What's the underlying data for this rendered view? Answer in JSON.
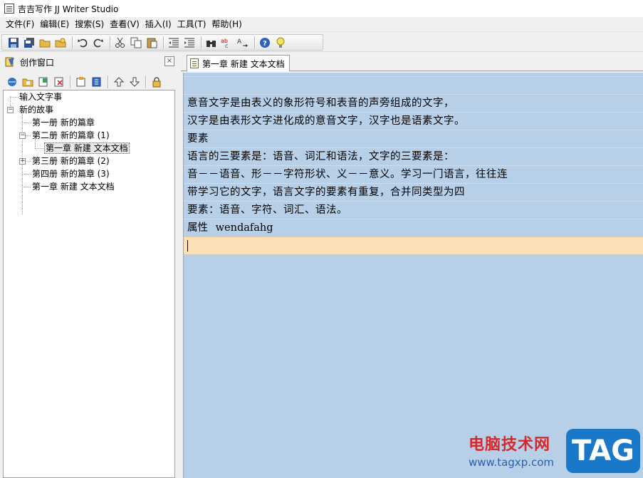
{
  "window": {
    "title": "吉吉写作 JJ Writer Studio"
  },
  "menu": [
    "文件(F)",
    "编辑(E)",
    "搜索(S)",
    "查看(V)",
    "插入(I)",
    "工具(T)",
    "帮助(H)"
  ],
  "toolbar": {
    "buttons": [
      "save-icon",
      "save-all-icon",
      "open-folder-icon",
      "export-icon",
      "undo-icon",
      "redo-icon",
      "cut-icon",
      "copy-icon",
      "paste-icon",
      "outdent-icon",
      "indent-icon",
      "find-icon",
      "spell-check-icon",
      "replace-icon",
      "help-icon",
      "tip-icon"
    ]
  },
  "left_panel": {
    "title": "创作窗口",
    "close_label": "⊠",
    "tree": [
      {
        "label": "输入文字事",
        "level": 0
      },
      {
        "label": "新的故事",
        "level": 0,
        "expander": "−"
      },
      {
        "label": "第一册 新的篇章",
        "level": 1
      },
      {
        "label": "第二册 新的篇章 (1)",
        "level": 1,
        "expander": "−"
      },
      {
        "label": "第一章 新建 文本文档",
        "level": 2,
        "selected": true
      },
      {
        "label": "第三册 新的篇章 (2)",
        "level": 1,
        "expander": "+"
      },
      {
        "label": "第四册 新的篇章 (3)",
        "level": 1
      },
      {
        "label": "第一章 新建 文本文档",
        "level": 1
      }
    ]
  },
  "editor": {
    "tab_label": "第一章 新建 文本文档",
    "lines": [
      "",
      "意音文字是由表义的象形符号和表音的声旁组成的文字，",
      "汉字是由表形文字进化成的意音文字，汉字也是语素文字。",
      "要素",
      "语言的三要素是：语音、词汇和语法，文字的三要素是：",
      "音－－语音、形－－字符形状、义－－意义。学习一门语言，往往连",
      "带学习它的文字，语言文字的要素有重复，合并同类型为四",
      "要素：语音、字符、词汇、语法。",
      "属性 wendafahg",
      ""
    ]
  },
  "watermark": {
    "text": "电脑技术网",
    "url": "www.tagxp.com",
    "tag": "TAG"
  }
}
